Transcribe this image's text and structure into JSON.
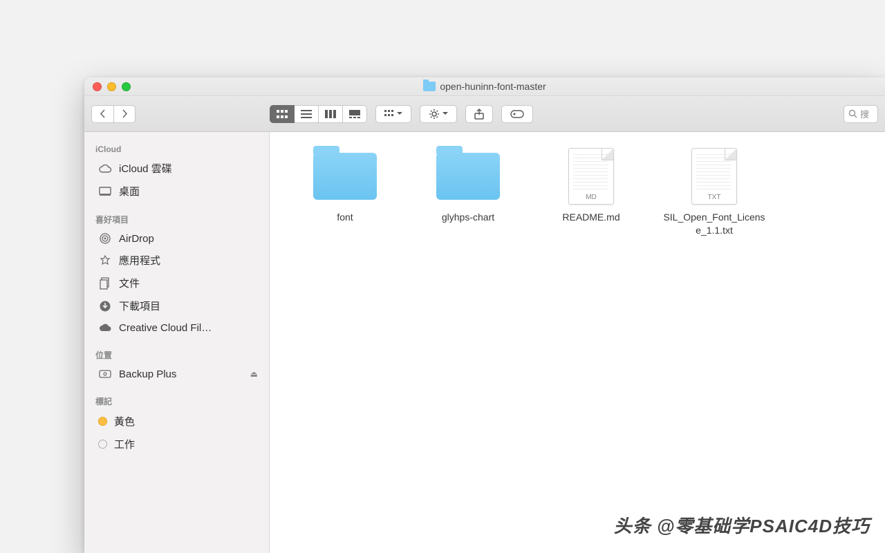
{
  "window": {
    "title": "open-huninn-font-master"
  },
  "toolbar": {
    "search_placeholder": "搜"
  },
  "sidebar": {
    "sections": [
      {
        "heading": "iCloud",
        "items": [
          {
            "label": "iCloud 雲碟",
            "icon": "cloud"
          },
          {
            "label": "桌面",
            "icon": "desktop"
          }
        ]
      },
      {
        "heading": "喜好項目",
        "items": [
          {
            "label": "AirDrop",
            "icon": "airdrop"
          },
          {
            "label": "應用程式",
            "icon": "apps"
          },
          {
            "label": "文件",
            "icon": "documents"
          },
          {
            "label": "下載項目",
            "icon": "downloads"
          },
          {
            "label": "Creative Cloud Fil…",
            "icon": "cc"
          }
        ]
      },
      {
        "heading": "位置",
        "items": [
          {
            "label": "Backup Plus",
            "icon": "drive",
            "eject": true
          }
        ]
      },
      {
        "heading": "標記",
        "items": [
          {
            "label": "黃色",
            "icon": "tag-yellow"
          },
          {
            "label": "工作",
            "icon": "tag-empty"
          }
        ]
      }
    ]
  },
  "files": [
    {
      "name": "font",
      "type": "folder"
    },
    {
      "name": "glyhps-chart",
      "type": "folder"
    },
    {
      "name": "README.md",
      "type": "doc",
      "badge": "MD"
    },
    {
      "name": "SIL_Open_Font_License_1.1.txt",
      "type": "doc",
      "badge": "TXT"
    }
  ],
  "watermark": "头条 @零基础学PSAIC4D技巧"
}
